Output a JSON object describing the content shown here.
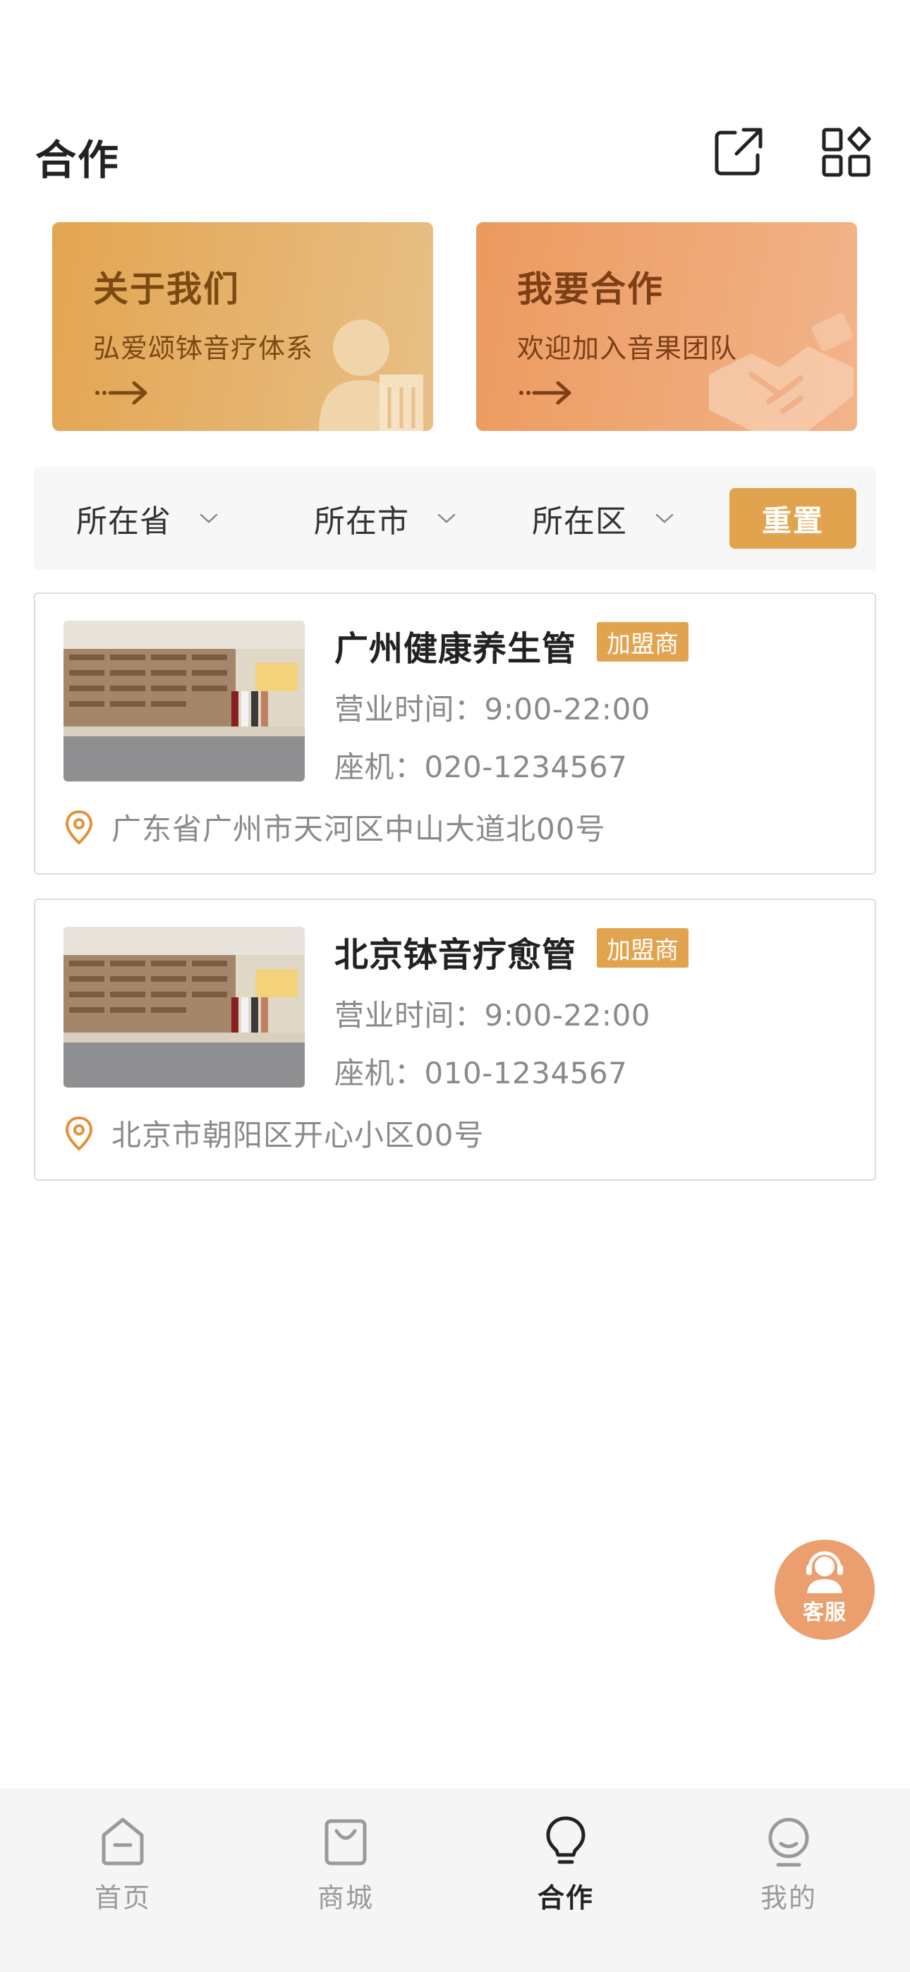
{
  "header": {
    "title": "合作",
    "icons": [
      "share-icon",
      "apps-icon"
    ]
  },
  "banners": [
    {
      "title": "关于我们",
      "subtitle": "弘爱颂钵音疗体系",
      "icon": "arrow-right-icon",
      "art": "person-building-icon",
      "color": "#e3a551"
    },
    {
      "title": "我要合作",
      "subtitle": "欢迎加入音果团队",
      "icon": "arrow-right-icon",
      "art": "handshake-icon",
      "color": "#ec9a5e"
    }
  ],
  "filters": {
    "province": "所在省",
    "city": "所在市",
    "district": "所在区",
    "reset": "重置"
  },
  "stores": [
    {
      "name": "广州健康养生管",
      "badge": "加盟商",
      "hours": "营业时间：9:00-22:00",
      "phone": "座机：020-1234567",
      "address": "广东省广州市天河区中山大道北00号"
    },
    {
      "name": "北京钵音疗愈管",
      "badge": "加盟商",
      "hours": "营业时间：9:00-22:00",
      "phone": "座机：010-1234567",
      "address": "北京市朝阳区开心小区00号"
    }
  ],
  "service": {
    "label": "客服",
    "icon": "customer-service-icon"
  },
  "tabbar": {
    "items": [
      {
        "label": "首页",
        "icon": "home-icon",
        "active": false
      },
      {
        "label": "商城",
        "icon": "shopping-bag-icon",
        "active": false
      },
      {
        "label": "合作",
        "icon": "lightbulb-icon",
        "active": true
      },
      {
        "label": "我的",
        "icon": "profile-icon",
        "active": false
      }
    ]
  },
  "colors": {
    "accent": "#e2a34e",
    "banner_about": "#e3a551",
    "banner_coop": "#ec9a5e",
    "service": "#eb9f6e",
    "tabbar_bg": "#f5f5f5"
  }
}
